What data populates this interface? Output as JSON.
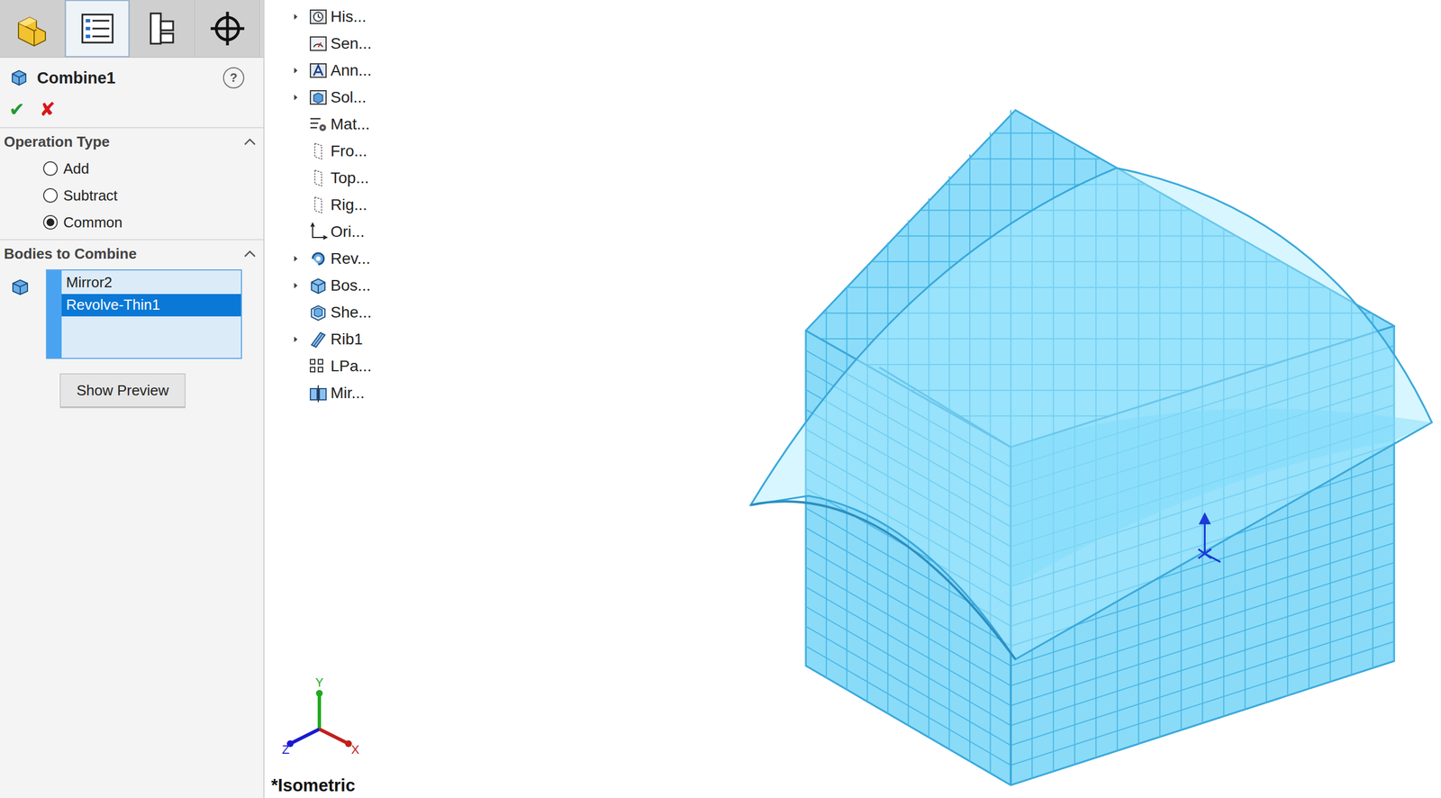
{
  "toolbar_tabs": [
    {
      "kind": "feature-manager",
      "selected": false
    },
    {
      "kind": "property-manager",
      "selected": true
    },
    {
      "kind": "configuration-manager",
      "selected": false
    },
    {
      "kind": "dimxpert-manager",
      "selected": false
    }
  ],
  "property_manager": {
    "title": "Combine1",
    "help": "?",
    "ok": "✔",
    "cancel": "✘"
  },
  "operation_type": {
    "title": "Operation Type",
    "expanded": true,
    "options": [
      {
        "label": "Add",
        "selected": false
      },
      {
        "label": "Subtract",
        "selected": false
      },
      {
        "label": "Common",
        "selected": true
      }
    ]
  },
  "bodies": {
    "title": "Bodies to Combine",
    "expanded": true,
    "items": [
      {
        "label": "Mirror2",
        "selected": false
      },
      {
        "label": "Revolve-Thin1",
        "selected": true
      }
    ]
  },
  "preview_button": "Show Preview",
  "feature_tree": [
    {
      "label": "His...",
      "kind": "history",
      "expandable": true
    },
    {
      "label": "Sen...",
      "kind": "sensors",
      "expandable": false
    },
    {
      "label": "Ann...",
      "kind": "annotations",
      "expandable": true
    },
    {
      "label": "Sol...",
      "kind": "solid-bodies",
      "expandable": true
    },
    {
      "label": "Mat...",
      "kind": "material",
      "expandable": false
    },
    {
      "label": "Fro...",
      "kind": "plane",
      "expandable": false
    },
    {
      "label": "Top...",
      "kind": "plane",
      "expandable": false
    },
    {
      "label": "Rig...",
      "kind": "plane",
      "expandable": false
    },
    {
      "label": "Ori...",
      "kind": "origin",
      "expandable": false
    },
    {
      "label": "Rev...",
      "kind": "revolve",
      "expandable": true
    },
    {
      "label": "Bos...",
      "kind": "boss",
      "expandable": true
    },
    {
      "label": "She...",
      "kind": "shell",
      "expandable": false
    },
    {
      "label": "Rib1",
      "kind": "rib",
      "expandable": true
    },
    {
      "label": "LPa...",
      "kind": "pattern",
      "expandable": false
    },
    {
      "label": "Mir...",
      "kind": "mirror",
      "expandable": false
    }
  ],
  "view": {
    "orientation": "*Isometric",
    "axes": [
      {
        "label": "Y",
        "color": "#1faa1f"
      },
      {
        "label": "Z",
        "color": "#1a1ad0"
      },
      {
        "label": "X",
        "color": "#c0201b"
      }
    ]
  }
}
